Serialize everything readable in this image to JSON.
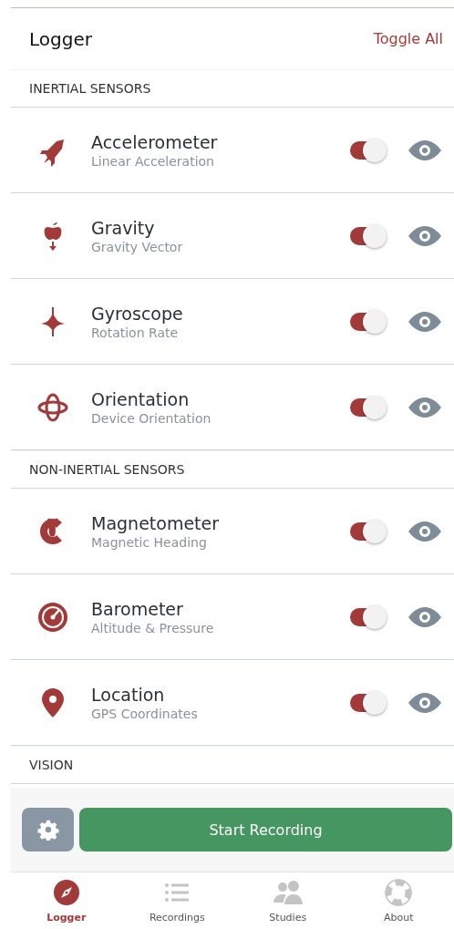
{
  "header": {
    "title": "Logger",
    "action": "Toggle All"
  },
  "sections": [
    {
      "title": "INERTIAL SENSORS",
      "sensors": [
        {
          "name": "Accelerometer",
          "subtitle": "Linear Acceleration",
          "on": true
        },
        {
          "name": "Gravity",
          "subtitle": "Gravity Vector",
          "on": true
        },
        {
          "name": "Gyroscope",
          "subtitle": "Rotation Rate",
          "on": true
        },
        {
          "name": "Orientation",
          "subtitle": "Device Orientation",
          "on": true
        }
      ]
    },
    {
      "title": "NON-INERTIAL SENSORS",
      "sensors": [
        {
          "name": "Magnetometer",
          "subtitle": "Magnetic Heading",
          "on": true
        },
        {
          "name": "Barometer",
          "subtitle": "Altitude & Pressure",
          "on": true
        },
        {
          "name": "Location",
          "subtitle": "GPS Coordinates",
          "on": true
        }
      ]
    },
    {
      "title": "VISION"
    }
  ],
  "record_button": "Start Recording",
  "nav": [
    {
      "label": "Logger",
      "selected": true
    },
    {
      "label": "Recordings",
      "selected": false
    },
    {
      "label": "Studies",
      "selected": false
    },
    {
      "label": "About",
      "selected": false
    }
  ]
}
